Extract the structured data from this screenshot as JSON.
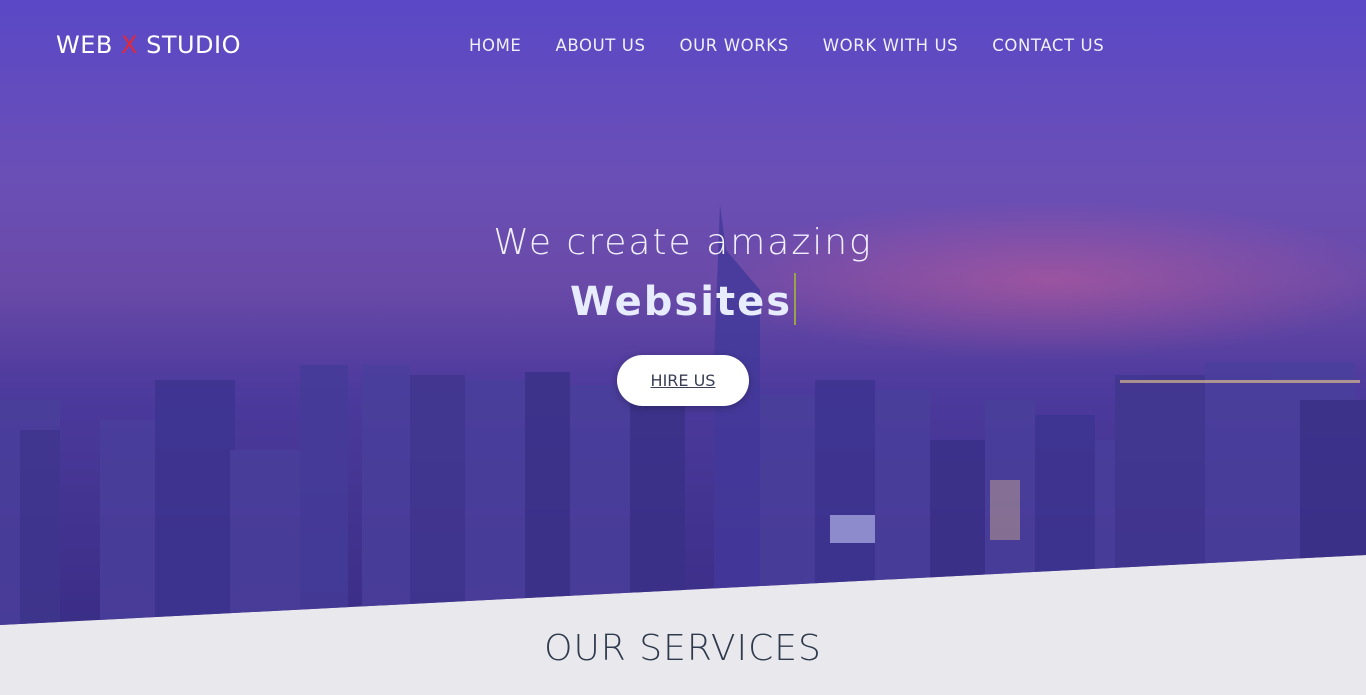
{
  "logo": {
    "part1": "WEB ",
    "x": "X",
    "part2": " STUDIO"
  },
  "nav": {
    "items": [
      "HOME",
      "ABOUT US",
      "OUR WORKS",
      "WORK WITH US",
      "CONTACT US"
    ]
  },
  "hero": {
    "headline": "We create amazing",
    "typed_word": "Websites",
    "cta_label": "HIRE US"
  },
  "services": {
    "title": "OUR SERVICES"
  },
  "colors": {
    "accent_x": "#e0293a",
    "hero_top": "#5a48c6",
    "section_bg": "#e9e8ec"
  }
}
